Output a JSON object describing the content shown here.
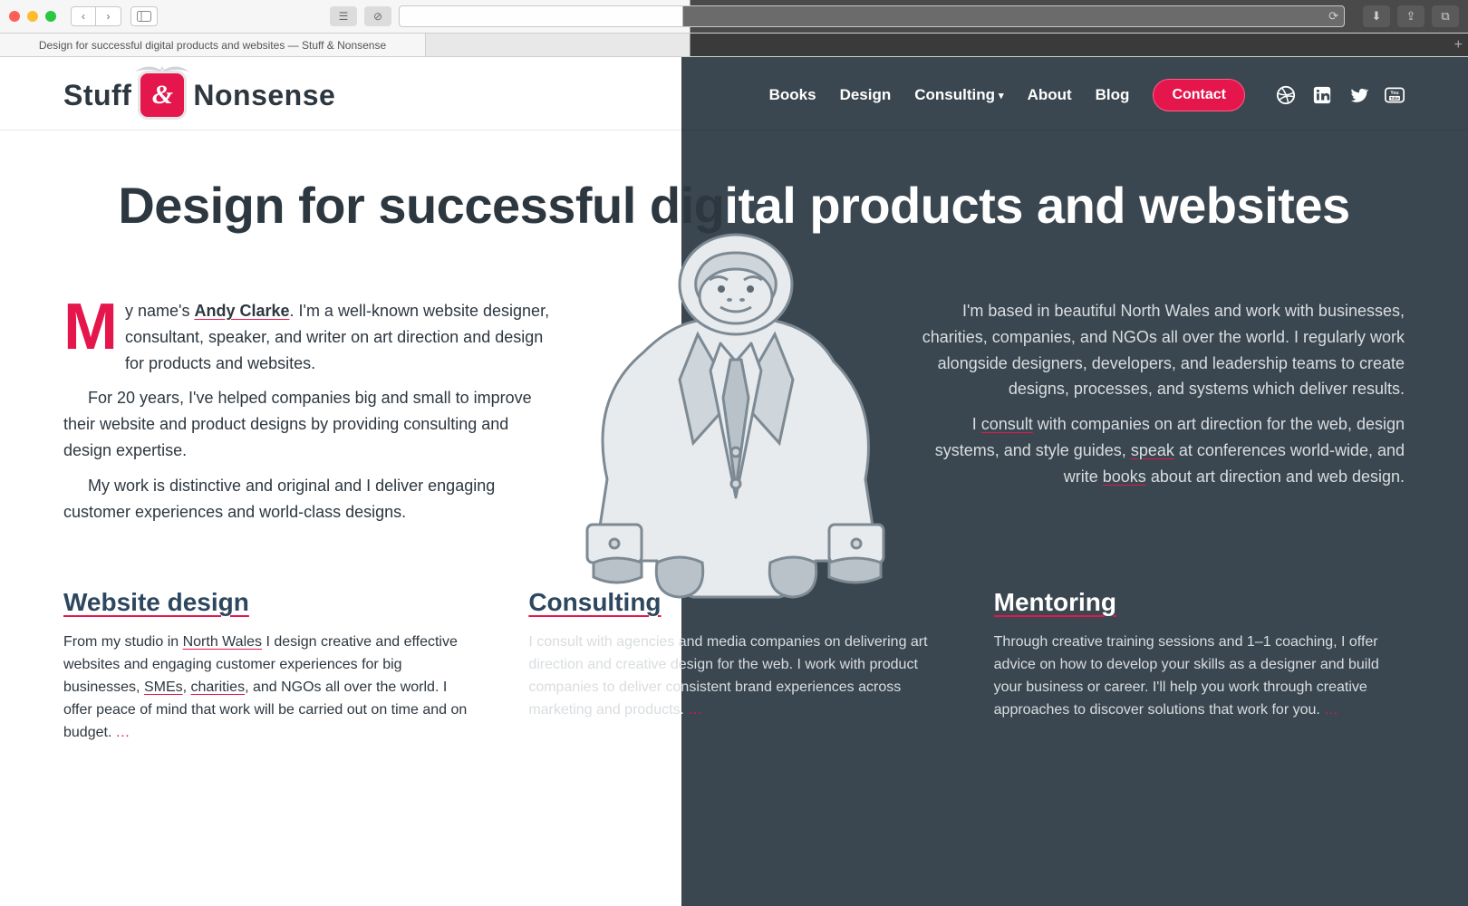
{
  "browser": {
    "tab_title": "Design for successful digital products and websites — Stuff & Nonsense"
  },
  "logo": {
    "word1": "Stuff",
    "amp": "&",
    "word2": "Nonsense"
  },
  "nav": {
    "items": [
      "Books",
      "Design",
      "Consulting",
      "About",
      "Blog"
    ],
    "contact": "Contact"
  },
  "hero": {
    "title_left": "Design for successful dig",
    "title_right": "ital products and websites"
  },
  "intro_left": {
    "dropcap": "M",
    "p1_a": "y name's ",
    "p1_link": "Andy Clarke",
    "p1_b": ". I'm a well-known website designer, consultant, speaker, and writer on art direction and design for products and websites.",
    "p2": "For 20 years, I've helped companies big and small to improve their website and product designs by providing consulting and design expertise.",
    "p3": "My work is distinctive and original and I deliver engaging customer experiences and world-class designs."
  },
  "intro_right": {
    "p1": "I'm based in beautiful North Wales and work with businesses, charities, companies, and NGOs all over the world. I regularly work alongside designers, developers, and leadership teams to create designs, processes, and systems which deliver results.",
    "p2_a": "I ",
    "p2_l1": "consult",
    "p2_b": " with companies on art direction for the web, design systems, and style guides, ",
    "p2_l2": "speak",
    "p2_c": " at conferences world-wide, and write ",
    "p2_l3": "books",
    "p2_d": " about art direction and web design."
  },
  "services": [
    {
      "title": "Website design",
      "body_a": "From my studio in ",
      "link1": "North Wales",
      "body_b": " I design creative and effective websites and engaging customer experiences for big businesses, ",
      "link2": "SMEs",
      "body_c": ", ",
      "link3": "charities",
      "body_d": ", and NGOs all over the world. I offer peace of mind that work will be carried out on time and on budget."
    },
    {
      "title": "Consulting",
      "body": "I consult with agencies and media companies on delivering art direction and creative design for the web. I work with product companies to deliver consistent brand experiences across marketing and products."
    },
    {
      "title": "Mentoring",
      "body": "Through creative training sessions and 1–1 coaching, I offer advice on how to develop your skills as a designer and build your business or career. I'll help you work through creative approaches to discover solutions that work for you."
    }
  ],
  "ellipsis": "…"
}
